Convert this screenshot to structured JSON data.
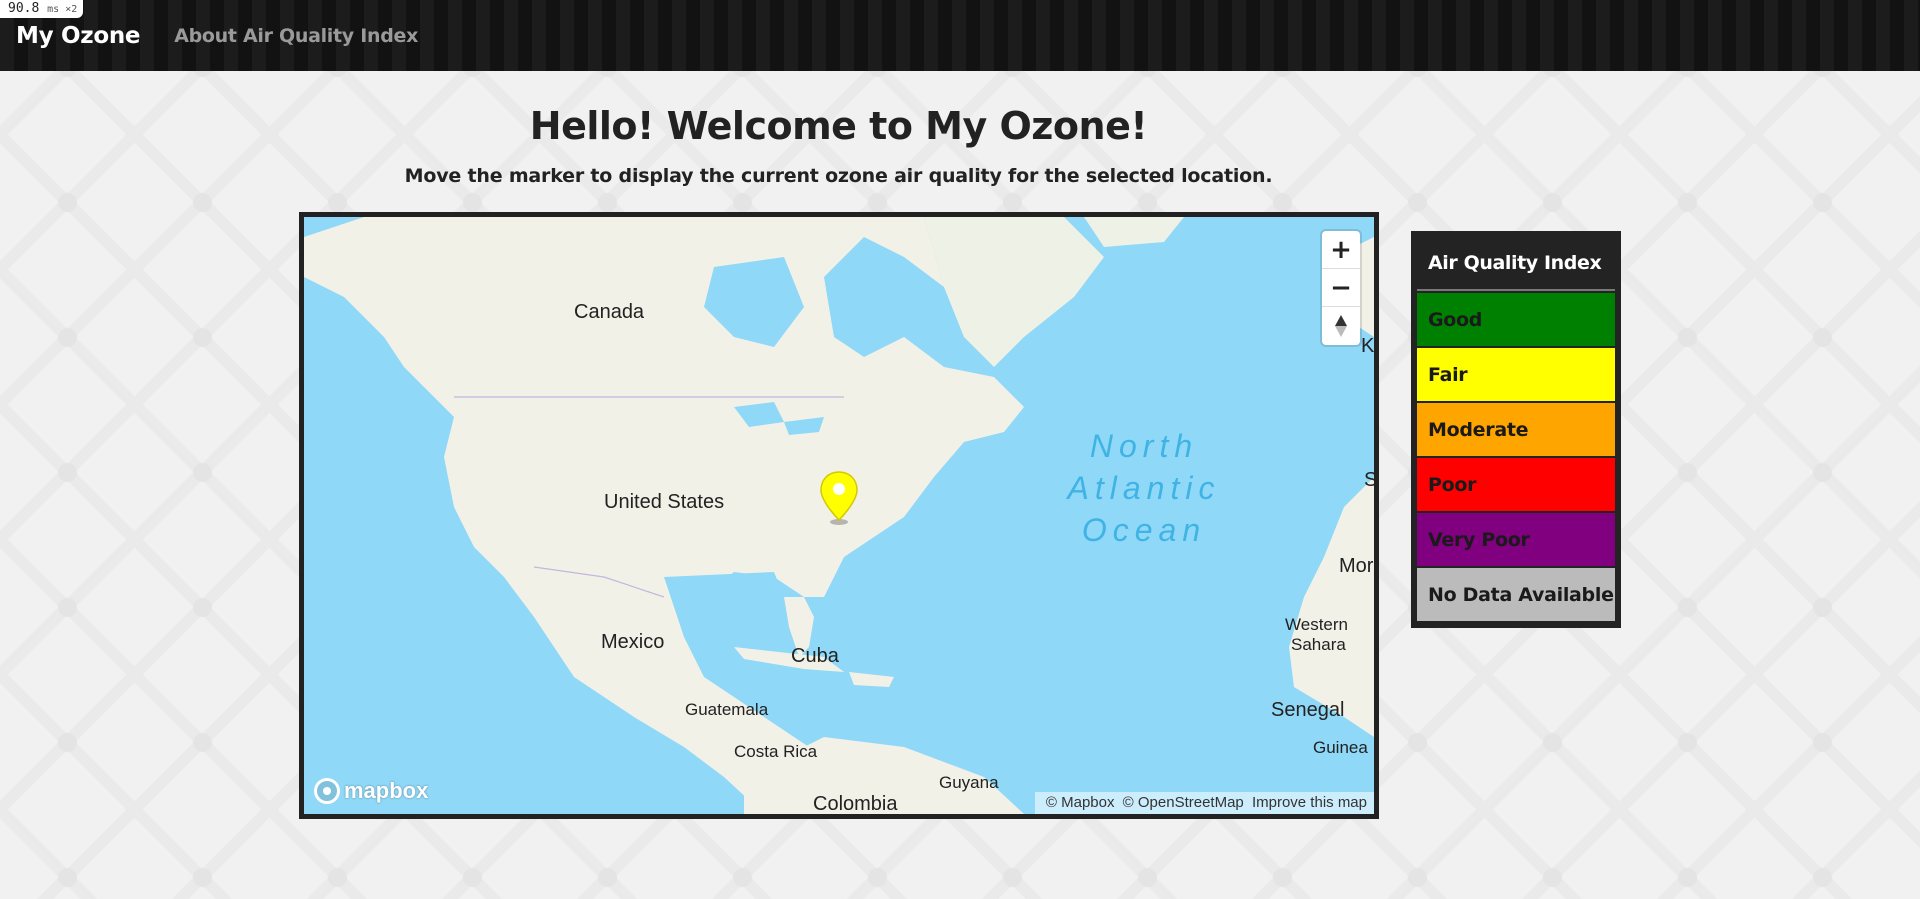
{
  "perf_overlay": {
    "value": "90.8",
    "unit": "ms ×2"
  },
  "nav": {
    "brand": "My Ozone",
    "links": [
      "About Air Quality Index"
    ]
  },
  "main": {
    "title": "Hello! Welcome to My Ozone!",
    "subtitle": "Move the marker to display the current ozone air quality for the selected location."
  },
  "map": {
    "labels": [
      "Canada",
      "United States",
      "Mexico",
      "Cuba",
      "Guatemala",
      "Costa Rica",
      "Guyana",
      "Colombia",
      "Western",
      "Sahara",
      "Senegal",
      "Guinea",
      "Mor",
      "K",
      "S"
    ],
    "ocean_label": [
      "North",
      "Atlantic",
      "Ocean"
    ],
    "controls": {
      "zoom_in": "+",
      "zoom_out": "−"
    },
    "marker_color": "#ffff00",
    "logo_text": "mapbox",
    "attribution": [
      "© Mapbox",
      "© OpenStreetMap",
      "Improve this map"
    ]
  },
  "legend": {
    "title": "Air Quality Index",
    "items": [
      {
        "label": "Good",
        "color": "#008000",
        "text_color": "#1a1a1a"
      },
      {
        "label": "Fair",
        "color": "#ffff00",
        "text_color": "#1a1a1a"
      },
      {
        "label": "Moderate",
        "color": "#ffa500",
        "text_color": "#1a1a1a"
      },
      {
        "label": "Poor",
        "color": "#ff0000",
        "text_color": "#1a1a1a"
      },
      {
        "label": "Very Poor",
        "color": "#800080",
        "text_color": "#1a1a1a"
      },
      {
        "label": "No Data Available",
        "color": "#bbbbbb",
        "text_color": "#1a1a1a"
      }
    ]
  }
}
